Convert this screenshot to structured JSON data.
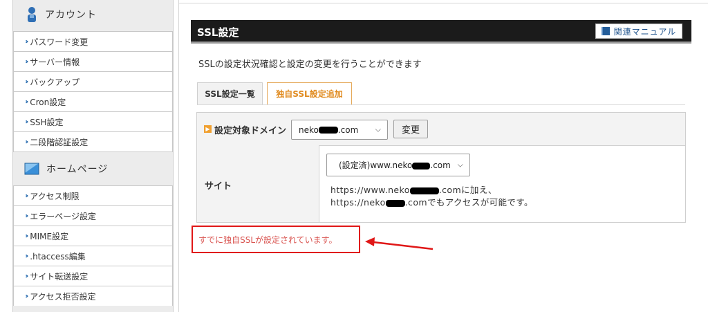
{
  "sidebar": {
    "account": {
      "heading": "アカウント",
      "items": [
        "パスワード変更",
        "サーバー情報",
        "バックアップ",
        "Cron設定",
        "SSH設定",
        "二段階認証設定"
      ]
    },
    "homepage": {
      "heading": "ホームページ",
      "items": [
        "アクセス制限",
        "エラーページ設定",
        "MIME設定",
        ".htaccess編集",
        "サイト転送設定",
        "アクセス拒否設定"
      ]
    }
  },
  "main": {
    "title": "SSL設定",
    "manual_button": "関連マニュアル",
    "description": "SSLの設定状況確認と設定の変更を行うことができます",
    "tabs": [
      {
        "label": "SSL設定一覧",
        "active": false
      },
      {
        "label": "独自SSL設定追加",
        "active": true
      }
    ],
    "form": {
      "domain_label": "設定対象ドメイン",
      "domain_value_prefix": "neko",
      "domain_value_suffix": ".com",
      "change_button": "変更",
      "site_label": "サイト",
      "site_value_prefix": "(設定済)www.neko",
      "site_value_suffix": ".com",
      "site_line1_prefix": "https://www.neko",
      "site_line1_suffix": ".comに加え、",
      "site_line2_prefix": "https://neko",
      "site_line2_suffix": ".comでもアクセスが可能です。"
    },
    "notice": "すでに独自SSLが設定されています。"
  },
  "colors": {
    "title_bar": "#1b1b1b",
    "active_tab": "#e08a1e",
    "annotation_red": "#e01717",
    "notice_text": "#d9534f"
  }
}
